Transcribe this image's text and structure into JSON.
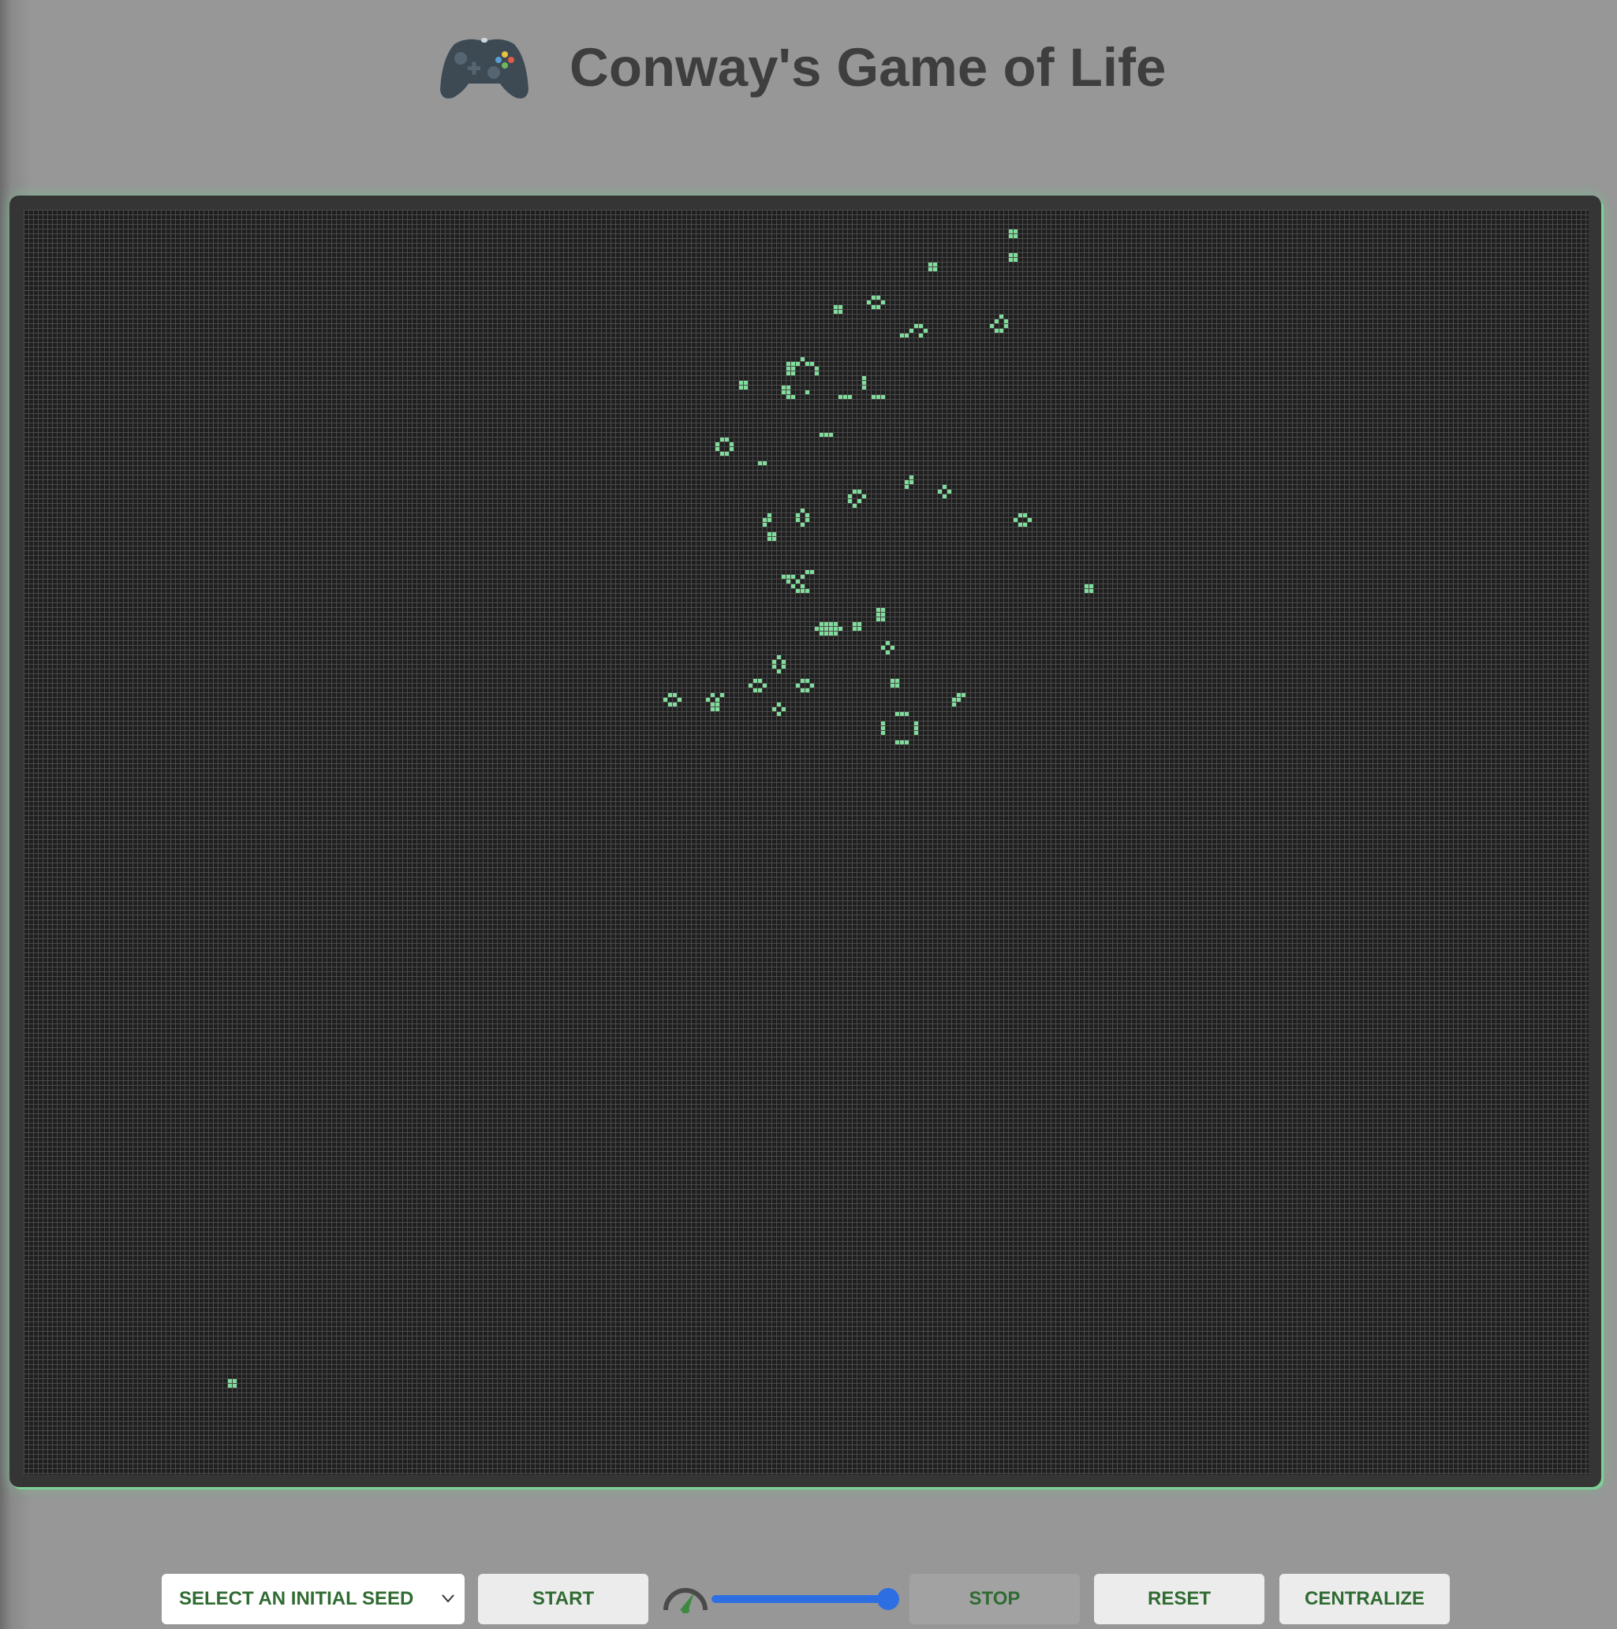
{
  "header": {
    "title": "Conway's Game of Life",
    "icon": "gamepad-icon"
  },
  "board": {
    "columns": 330,
    "rows": 267,
    "cell_color": "#7fdc9b",
    "grid_line_color": "#4a4a4a",
    "background_color": "#1f1f1f",
    "live_cells": [
      [
        208,
        4
      ],
      [
        209,
        4
      ],
      [
        208,
        5
      ],
      [
        209,
        5
      ],
      [
        208,
        9
      ],
      [
        209,
        9
      ],
      [
        208,
        10
      ],
      [
        209,
        10
      ],
      [
        191,
        11
      ],
      [
        192,
        11
      ],
      [
        191,
        12
      ],
      [
        192,
        12
      ],
      [
        171,
        20
      ],
      [
        172,
        20
      ],
      [
        171,
        21
      ],
      [
        172,
        21
      ],
      [
        179,
        18
      ],
      [
        180,
        18
      ],
      [
        178,
        19
      ],
      [
        181,
        19
      ],
      [
        179,
        20
      ],
      [
        180,
        20
      ],
      [
        206,
        22
      ],
      [
        205,
        23
      ],
      [
        207,
        23
      ],
      [
        204,
        24
      ],
      [
        207,
        24
      ],
      [
        205,
        25
      ],
      [
        206,
        25
      ],
      [
        188,
        24
      ],
      [
        189,
        24
      ],
      [
        187,
        25
      ],
      [
        190,
        25
      ],
      [
        185,
        26
      ],
      [
        186,
        26
      ],
      [
        189,
        26
      ],
      [
        151,
        36
      ],
      [
        152,
        36
      ],
      [
        151,
        37
      ],
      [
        152,
        37
      ],
      [
        164,
        31
      ],
      [
        161,
        32
      ],
      [
        162,
        32
      ],
      [
        163,
        32
      ],
      [
        165,
        32
      ],
      [
        166,
        32
      ],
      [
        161,
        33
      ],
      [
        162,
        33
      ],
      [
        167,
        33
      ],
      [
        161,
        34
      ],
      [
        162,
        34
      ],
      [
        167,
        34
      ],
      [
        160,
        37
      ],
      [
        161,
        37
      ],
      [
        160,
        38
      ],
      [
        161,
        38
      ],
      [
        165,
        38
      ],
      [
        161,
        39
      ],
      [
        162,
        39
      ],
      [
        177,
        35
      ],
      [
        177,
        36
      ],
      [
        177,
        37
      ],
      [
        172,
        39
      ],
      [
        173,
        39
      ],
      [
        174,
        39
      ],
      [
        179,
        39
      ],
      [
        180,
        39
      ],
      [
        181,
        39
      ],
      [
        168,
        47
      ],
      [
        169,
        47
      ],
      [
        170,
        47
      ],
      [
        147,
        48
      ],
      [
        148,
        48
      ],
      [
        146,
        49
      ],
      [
        149,
        49
      ],
      [
        146,
        50
      ],
      [
        149,
        50
      ],
      [
        147,
        51
      ],
      [
        148,
        51
      ],
      [
        155,
        53
      ],
      [
        156,
        53
      ],
      [
        187,
        56
      ],
      [
        186,
        57
      ],
      [
        187,
        57
      ],
      [
        186,
        58
      ],
      [
        194,
        58
      ],
      [
        193,
        59
      ],
      [
        195,
        59
      ],
      [
        194,
        60
      ],
      [
        175,
        59
      ],
      [
        176,
        59
      ],
      [
        174,
        60
      ],
      [
        177,
        60
      ],
      [
        174,
        61
      ],
      [
        176,
        61
      ],
      [
        175,
        62
      ],
      [
        157,
        64
      ],
      [
        156,
        65
      ],
      [
        157,
        65
      ],
      [
        156,
        66
      ],
      [
        164,
        63
      ],
      [
        163,
        64
      ],
      [
        165,
        64
      ],
      [
        163,
        65
      ],
      [
        165,
        65
      ],
      [
        164,
        66
      ],
      [
        157,
        68
      ],
      [
        158,
        68
      ],
      [
        157,
        69
      ],
      [
        158,
        69
      ],
      [
        210,
        64
      ],
      [
        211,
        64
      ],
      [
        209,
        65
      ],
      [
        212,
        65
      ],
      [
        210,
        66
      ],
      [
        211,
        66
      ],
      [
        224,
        79
      ],
      [
        225,
        79
      ],
      [
        224,
        80
      ],
      [
        225,
        80
      ],
      [
        165,
        76
      ],
      [
        166,
        76
      ],
      [
        160,
        77
      ],
      [
        161,
        77
      ],
      [
        162,
        77
      ],
      [
        164,
        77
      ],
      [
        161,
        78
      ],
      [
        163,
        78
      ],
      [
        162,
        79
      ],
      [
        164,
        79
      ],
      [
        163,
        80
      ],
      [
        164,
        80
      ],
      [
        165,
        80
      ],
      [
        180,
        84
      ],
      [
        181,
        84
      ],
      [
        180,
        85
      ],
      [
        181,
        85
      ],
      [
        180,
        86
      ],
      [
        181,
        86
      ],
      [
        168,
        87
      ],
      [
        169,
        87
      ],
      [
        170,
        87
      ],
      [
        171,
        87
      ],
      [
        167,
        88
      ],
      [
        168,
        88
      ],
      [
        169,
        88
      ],
      [
        170,
        88
      ],
      [
        171,
        88
      ],
      [
        172,
        88
      ],
      [
        168,
        89
      ],
      [
        169,
        89
      ],
      [
        170,
        89
      ],
      [
        171,
        89
      ],
      [
        175,
        87
      ],
      [
        176,
        87
      ],
      [
        175,
        88
      ],
      [
        176,
        88
      ],
      [
        182,
        91
      ],
      [
        181,
        92
      ],
      [
        183,
        92
      ],
      [
        182,
        93
      ],
      [
        159,
        94
      ],
      [
        158,
        95
      ],
      [
        160,
        95
      ],
      [
        158,
        96
      ],
      [
        160,
        96
      ],
      [
        159,
        97
      ],
      [
        183,
        99
      ],
      [
        184,
        99
      ],
      [
        183,
        100
      ],
      [
        184,
        100
      ],
      [
        154,
        99
      ],
      [
        155,
        99
      ],
      [
        153,
        100
      ],
      [
        156,
        100
      ],
      [
        154,
        101
      ],
      [
        155,
        101
      ],
      [
        164,
        99
      ],
      [
        165,
        99
      ],
      [
        163,
        100
      ],
      [
        166,
        100
      ],
      [
        164,
        101
      ],
      [
        165,
        101
      ],
      [
        136,
        102
      ],
      [
        137,
        102
      ],
      [
        135,
        103
      ],
      [
        138,
        103
      ],
      [
        136,
        104
      ],
      [
        137,
        104
      ],
      [
        145,
        102
      ],
      [
        147,
        102
      ],
      [
        144,
        103
      ],
      [
        146,
        103
      ],
      [
        145,
        104
      ],
      [
        146,
        104
      ],
      [
        145,
        105
      ],
      [
        146,
        105
      ],
      [
        197,
        102
      ],
      [
        198,
        102
      ],
      [
        196,
        103
      ],
      [
        197,
        103
      ],
      [
        196,
        104
      ],
      [
        159,
        104
      ],
      [
        158,
        105
      ],
      [
        160,
        105
      ],
      [
        159,
        106
      ],
      [
        184,
        106
      ],
      [
        185,
        106
      ],
      [
        186,
        106
      ],
      [
        181,
        108
      ],
      [
        188,
        108
      ],
      [
        181,
        109
      ],
      [
        188,
        109
      ],
      [
        181,
        110
      ],
      [
        188,
        110
      ],
      [
        184,
        112
      ],
      [
        185,
        112
      ],
      [
        186,
        112
      ],
      [
        43,
        247
      ],
      [
        44,
        247
      ],
      [
        43,
        248
      ],
      [
        44,
        248
      ]
    ]
  },
  "controls": {
    "seed_select": {
      "selected": "SELECT AN INITIAL SEED"
    },
    "start_label": "START",
    "speed": {
      "icon": "speedometer-icon",
      "value_fraction": 1.0
    },
    "stop_label": "STOP",
    "reset_label": "RESET",
    "centralize_label": "CENTRALIZE"
  },
  "colors": {
    "accent": "#2d6fe3",
    "button_text": "#2f6b32",
    "board_glow": "#7cd296",
    "page_background": "#979797"
  }
}
